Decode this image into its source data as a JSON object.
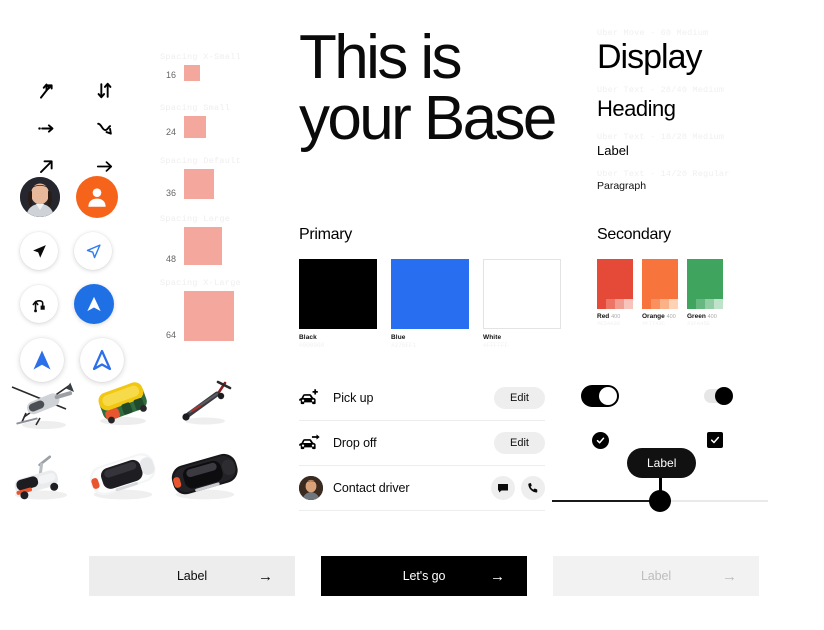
{
  "headline": "This is your Base",
  "icon_grid": {
    "icons": [
      {
        "name": "merge-right-icon"
      },
      {
        "name": "arrows-up-down-icon"
      },
      {
        "name": "arrow-right-dashed-icon"
      },
      {
        "name": "turn-down-right-icon"
      },
      {
        "name": "arrow-up-right-icon"
      },
      {
        "name": "arrow-right-icon"
      }
    ]
  },
  "avatars_pucks": {
    "items": [
      {
        "name": "avatar-photo"
      },
      {
        "name": "avatar-person-orange"
      },
      {
        "name": "nav-cursor-black-puck"
      },
      {
        "name": "nav-cursor-blue-puck"
      },
      {
        "name": "route-puck"
      },
      {
        "name": "nav-arrow-blue-filled-puck"
      },
      {
        "name": "nav-arrow-blue-puck"
      },
      {
        "name": "nav-arrow-blue-outline-puck"
      }
    ]
  },
  "vehicles": {
    "items": [
      {
        "name": "helicopter-illustration"
      },
      {
        "name": "auto-rickshaw-illustration"
      },
      {
        "name": "kick-scooter-illustration"
      },
      {
        "name": "moped-illustration"
      },
      {
        "name": "white-car-illustration"
      },
      {
        "name": "black-car-illustration"
      }
    ]
  },
  "spacing": {
    "steps": [
      {
        "title": "Spacing X-Small",
        "value": "16",
        "size": 16
      },
      {
        "title": "Spacing Small",
        "value": "24",
        "size": 22
      },
      {
        "title": "Spacing Default",
        "value": "36",
        "size": 30
      },
      {
        "title": "Spacing Large",
        "value": "48",
        "size": 38
      },
      {
        "title": "Spacing X-Large",
        "value": "64",
        "size": 50
      }
    ]
  },
  "typescale": {
    "items": [
      {
        "note": "Uber Move - 60 Medium",
        "sample": "Display"
      },
      {
        "note": "Uber Text - 28/40 Medium",
        "sample": "Heading"
      },
      {
        "note": "Uber Text - 18/28 Medium",
        "sample": "Label"
      },
      {
        "note": "Uber Text - 14/20 Regular",
        "sample": "Paragraph"
      }
    ]
  },
  "primary_colors": {
    "title": "Primary",
    "swatches": [
      {
        "name": "Black",
        "hex": "#000000"
      },
      {
        "name": "Blue",
        "hex": "#276EF1"
      },
      {
        "name": "White",
        "hex": "#FFFFFF"
      }
    ]
  },
  "secondary_colors": {
    "title": "Secondary",
    "swatches": [
      {
        "name": "Red",
        "weight": "400",
        "hex": "#E54A38",
        "tints": [
          "#E54A38",
          "#ED7565",
          "#F29D91",
          "#F7C4BC"
        ]
      },
      {
        "name": "Orange",
        "weight": "400",
        "hex": "#F7743C",
        "tints": [
          "#F7743C",
          "#F9905F",
          "#FBB288",
          "#FDD2B6"
        ]
      },
      {
        "name": "Green",
        "weight": "400",
        "hex": "#3FA45E",
        "tints": [
          "#3FA45E",
          "#66B880",
          "#93CDA5",
          "#C0E2CB"
        ]
      }
    ]
  },
  "list_rows": [
    {
      "icon": "car-pickup-icon",
      "label": "Pick up",
      "action": "Edit"
    },
    {
      "icon": "car-dropoff-icon",
      "label": "Drop off",
      "action": "Edit"
    },
    {
      "icon": "driver-avatar",
      "label": "Contact driver",
      "action": null
    }
  ],
  "controls": {
    "toggle_large_on": true,
    "toggle_small_on": true,
    "radio_checked": true,
    "checkbox_checked": true,
    "slider_tooltip": "Label",
    "slider_value": 50
  },
  "buttons": [
    {
      "label": "Label",
      "style": "secondary"
    },
    {
      "label": "Let's go",
      "style": "primary"
    },
    {
      "label": "Label",
      "style": "disabled"
    }
  ]
}
